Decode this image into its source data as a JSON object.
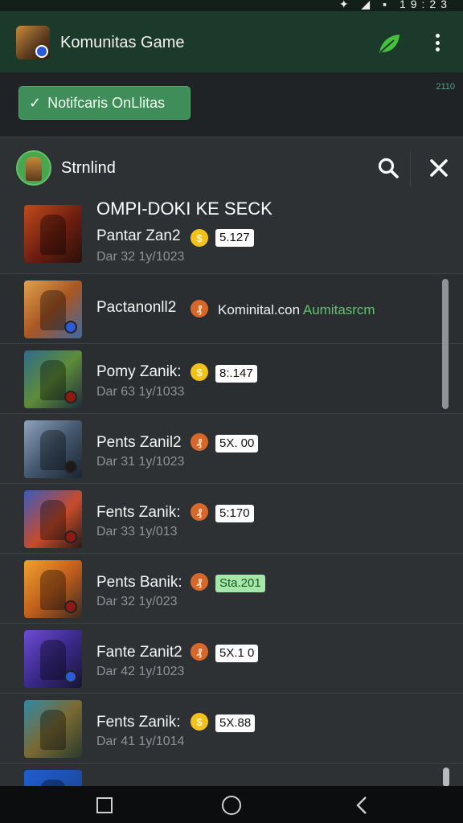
{
  "status_bar": {
    "time": "19:23"
  },
  "app_bar": {
    "title": "Komunitas Game"
  },
  "banner": {
    "button_label": "Notifcaris OnLlitas",
    "time": "2110"
  },
  "panel": {
    "title": "Strnlind",
    "headline": "OMPI-DOKI KE SECK",
    "items": [
      {
        "name": "Pantar Zan2",
        "date": "Dar 32 1y/1023",
        "coin": "gold",
        "score": "5.127"
      },
      {
        "name": "Pactanonll2",
        "coin": "copper",
        "text": "Kominital.con",
        "text_green": "Aumitasrcm"
      },
      {
        "name": "Pomy Zanik:",
        "date": "Dar 63 1y/1033",
        "coin": "gold",
        "score": "8:.147"
      },
      {
        "name": "Pents Zanil2",
        "date": "Dar 31 1y/1023",
        "coin": "copper",
        "score": "5X. 00"
      },
      {
        "name": "Fents Zanik:",
        "date": "Dar 33 1y/013",
        "coin": "copper",
        "score": "5:170"
      },
      {
        "name": "Pents Banik:",
        "date": "Dar 32 1y/023",
        "coin": "copper",
        "score": "Sta.201",
        "score_style": "green"
      },
      {
        "name": "Fante Zanit2",
        "date": "Dar 42 1y/1023",
        "coin": "copper",
        "score": "5X.1 0"
      },
      {
        "name": "Fents Zanik:",
        "date": "Dar 41 1y/1014",
        "coin": "gold",
        "score": "5X.88"
      }
    ]
  },
  "colors": {
    "app_bar": "#1c3a2b",
    "accent_green": "#3f8d58",
    "panel_bg": "#2d3134"
  },
  "icons": [
    "leaf-icon",
    "more-vert-icon",
    "check-icon",
    "search-icon",
    "close-icon",
    "coin-icon",
    "square-icon",
    "circle-icon",
    "back-icon"
  ]
}
